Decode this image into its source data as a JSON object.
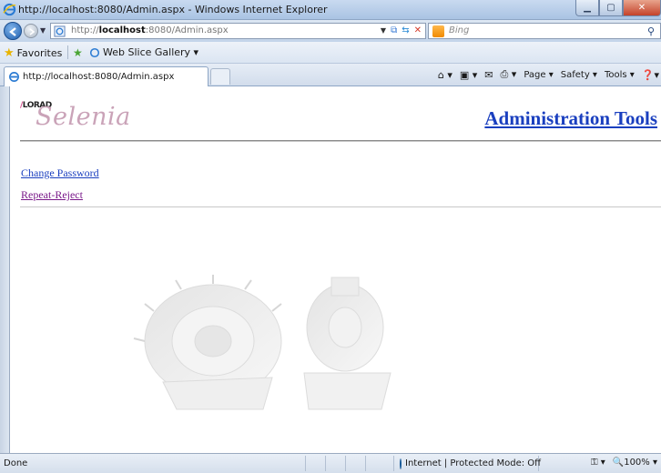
{
  "window": {
    "title": "http://localhost:8080/Admin.aspx - Windows Internet Explorer"
  },
  "navigation": {
    "url_prefix": "http://",
    "url_host": "localhost",
    "url_rest": ":8080/Admin.aspx",
    "search_placeholder": "Bing"
  },
  "favorites_bar": {
    "favorites_label": "Favorites",
    "web_slice_label": "Web Slice Gallery ▾"
  },
  "tab": {
    "label": "http://localhost:8080/Admin.aspx"
  },
  "command_bar": {
    "page_label": "Page ▾",
    "safety_label": "Safety ▾",
    "tools_label": "Tools ▾"
  },
  "page": {
    "logo_brand": "LORAD",
    "logo_product": "Selenia",
    "title": "Administration Tools",
    "links": [
      {
        "label": "Change Password"
      },
      {
        "label": "Repeat-Reject"
      }
    ]
  },
  "status_bar": {
    "status_text": "Done",
    "zone_text": "Internet | Protected Mode: Off",
    "zoom_text": "100%"
  },
  "colors": {
    "link": "#1a3fbf",
    "visited_link": "#7a1a8a",
    "logo_pink": "#caa3b8"
  }
}
